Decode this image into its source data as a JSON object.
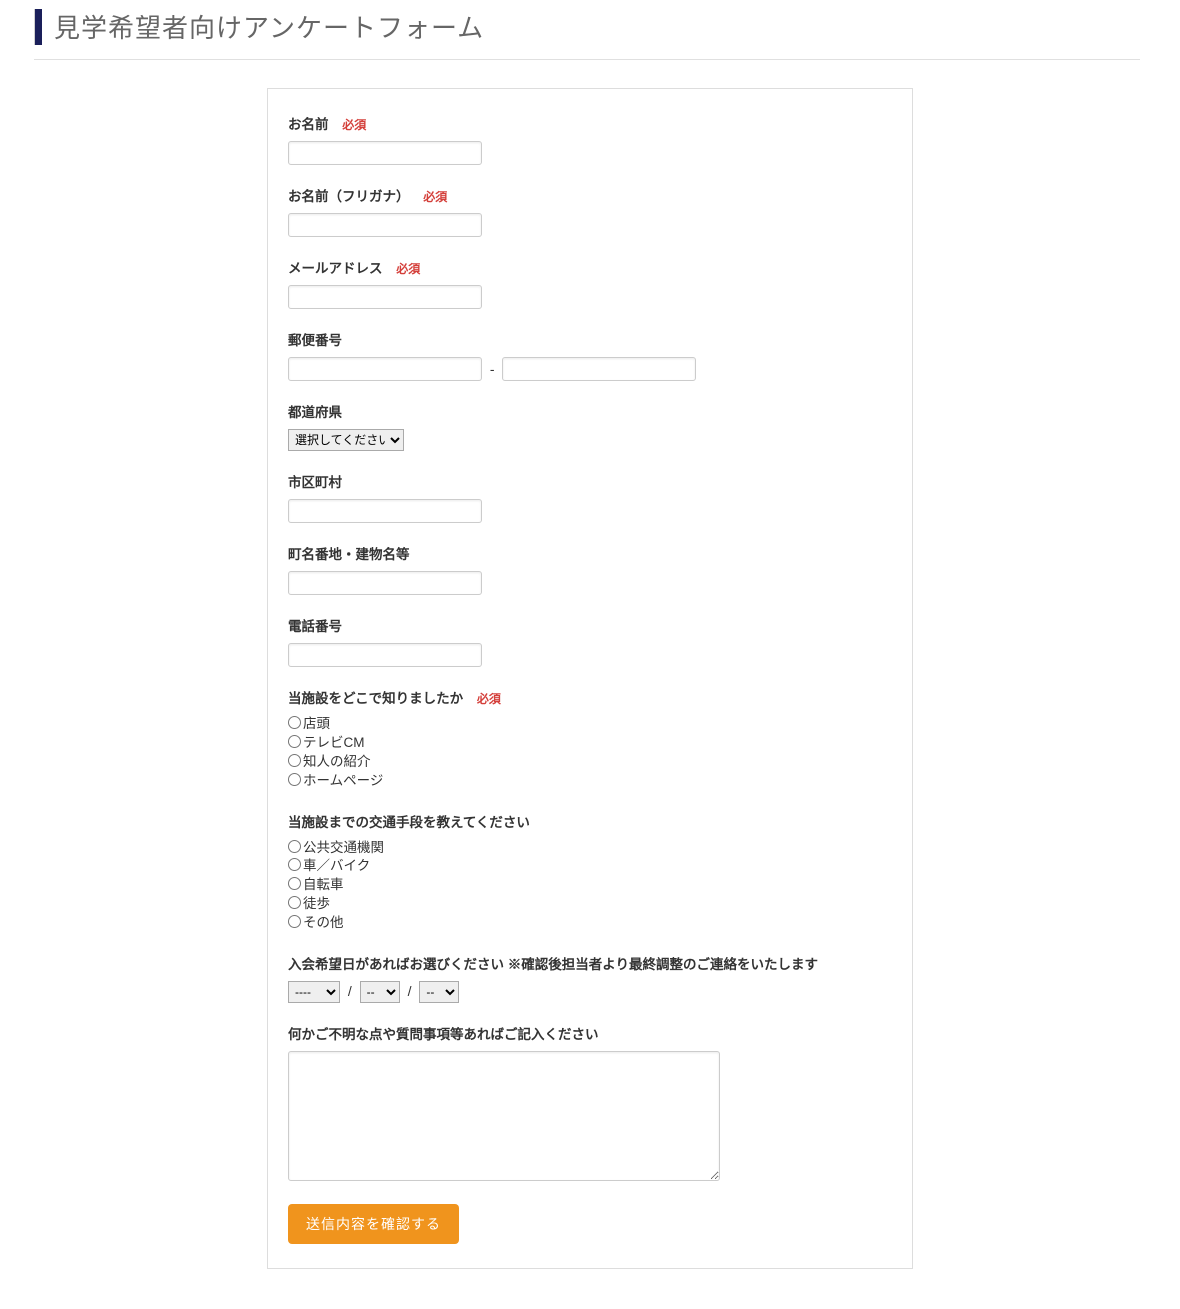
{
  "header": {
    "title": "見学希望者向けアンケートフォーム"
  },
  "labels": {
    "required": "必須",
    "name": "お名前",
    "name_kana": "お名前（フリガナ）",
    "email": "メールアドレス",
    "zip": "郵便番号",
    "zip_sep": "-",
    "pref": "都道府県",
    "city": "市区町村",
    "addr": "町名番地・建物名等",
    "tel": "電話番号",
    "how_known": "当施設をどこで知りましたか",
    "transport": "当施設までの交通手段を教えてください",
    "join_date": "入会希望日があればお選びください ※確認後担当者より最終調整のご連絡をいたします",
    "comments": "何かご不明な点や質問事項等あればご記入ください",
    "date_sep": "/",
    "submit": "送信内容を確認する"
  },
  "placeholders": {
    "pref": "選択してください",
    "year": "----",
    "month": "--",
    "day": "--"
  },
  "options": {
    "how_known": [
      "店頭",
      "テレビCM",
      "知人の紹介",
      "ホームページ"
    ],
    "transport": [
      "公共交通機関",
      "車／バイク",
      "自転車",
      "徒歩",
      "その他"
    ]
  }
}
